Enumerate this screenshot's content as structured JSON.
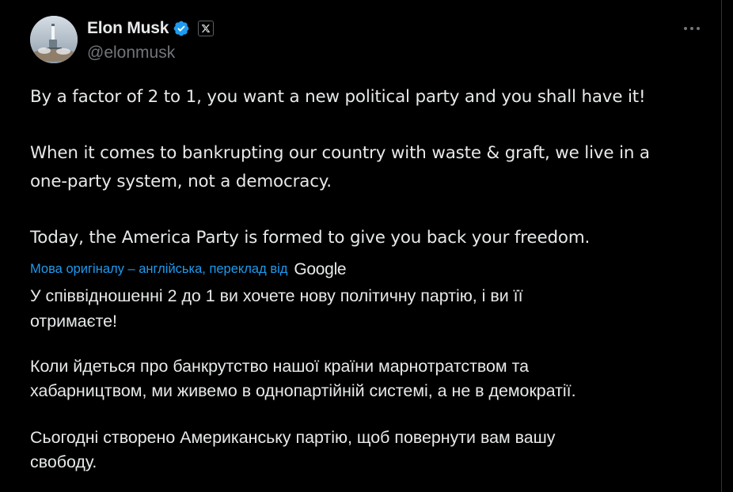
{
  "author": {
    "display_name": "Elon Musk",
    "handle": "@elonmusk",
    "verified": true,
    "affiliate_badge_icon": "x-logo-icon",
    "verified_color": "#1d9bf0"
  },
  "menu": {
    "icon": "more-horizontal-icon"
  },
  "tweet": {
    "lines": [
      "By a factor of 2 to 1, you want a new political party and you shall have it!",
      "When it comes to bankrupting our country with waste & graft, we live in a",
      "one-party system, not a democracy.",
      "Today, the America Party is formed to give you back your freedom."
    ]
  },
  "translation": {
    "notice": "Мова оригіналу – англійська, переклад від",
    "provider": "Google",
    "lines": [
      "У співвідношенні 2 до 1 ви хочете нову політичну партію, і ви її",
      "отримаєте!",
      "Коли йдеться про банкрутство нашої країни марнотратством та",
      "хабарництвом, ми живемо в однопартійній системі, а не в демократії.",
      "Сьогодні створено Американську партію, щоб повернути вам вашу",
      "свободу."
    ]
  },
  "colors": {
    "background": "#000000",
    "text": "#e7e9ea",
    "secondary_text": "#71767b",
    "link": "#1d9bf0"
  }
}
